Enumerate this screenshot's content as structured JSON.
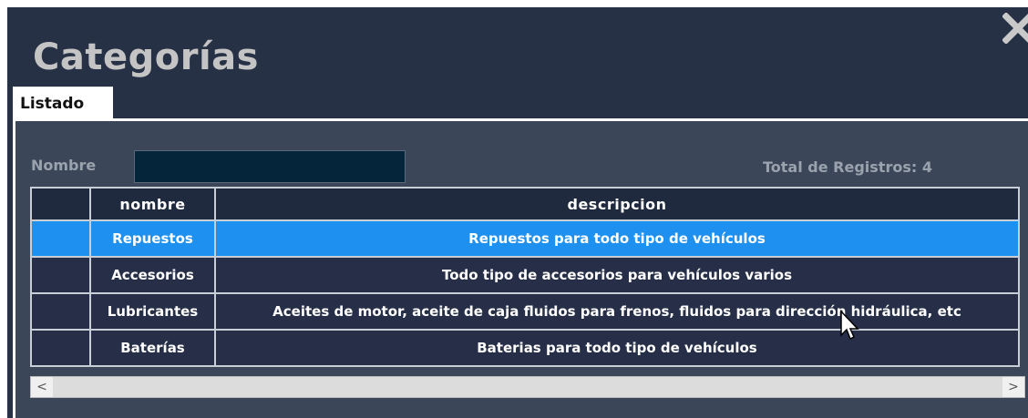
{
  "window": {
    "title": "Categorías"
  },
  "tabs": [
    {
      "label": "Listado"
    }
  ],
  "filter": {
    "label": "Nombre",
    "value": "",
    "placeholder": ""
  },
  "total": {
    "label": "Total de Registros: 4"
  },
  "table": {
    "headers": [
      "nombre",
      "descripcion"
    ],
    "rows": [
      {
        "nombre": "Repuestos",
        "descripcion": "Repuestos para todo tipo de vehículos",
        "selected": true
      },
      {
        "nombre": "Accesorios",
        "descripcion": "Todo tipo de accesorios para vehículos varios",
        "selected": false
      },
      {
        "nombre": "Lubricantes",
        "descripcion": "Aceites de motor, aceite de caja fluidos para frenos, fluidos para dirección hidráulica, etc",
        "selected": false
      },
      {
        "nombre": "Baterías",
        "descripcion": "Baterias para todo tipo de vehículos",
        "selected": false
      }
    ]
  },
  "scrollbar": {
    "left_arrow": "<",
    "right_arrow": ">"
  },
  "colors": {
    "window_bg": "#273145",
    "panel_bg": "#3b4759",
    "selected_row": "#1e90f0",
    "row_bg": "#262f47",
    "input_bg": "#05263a"
  },
  "icons": {
    "close": "close-icon",
    "cursor": "mouse-pointer-icon"
  }
}
